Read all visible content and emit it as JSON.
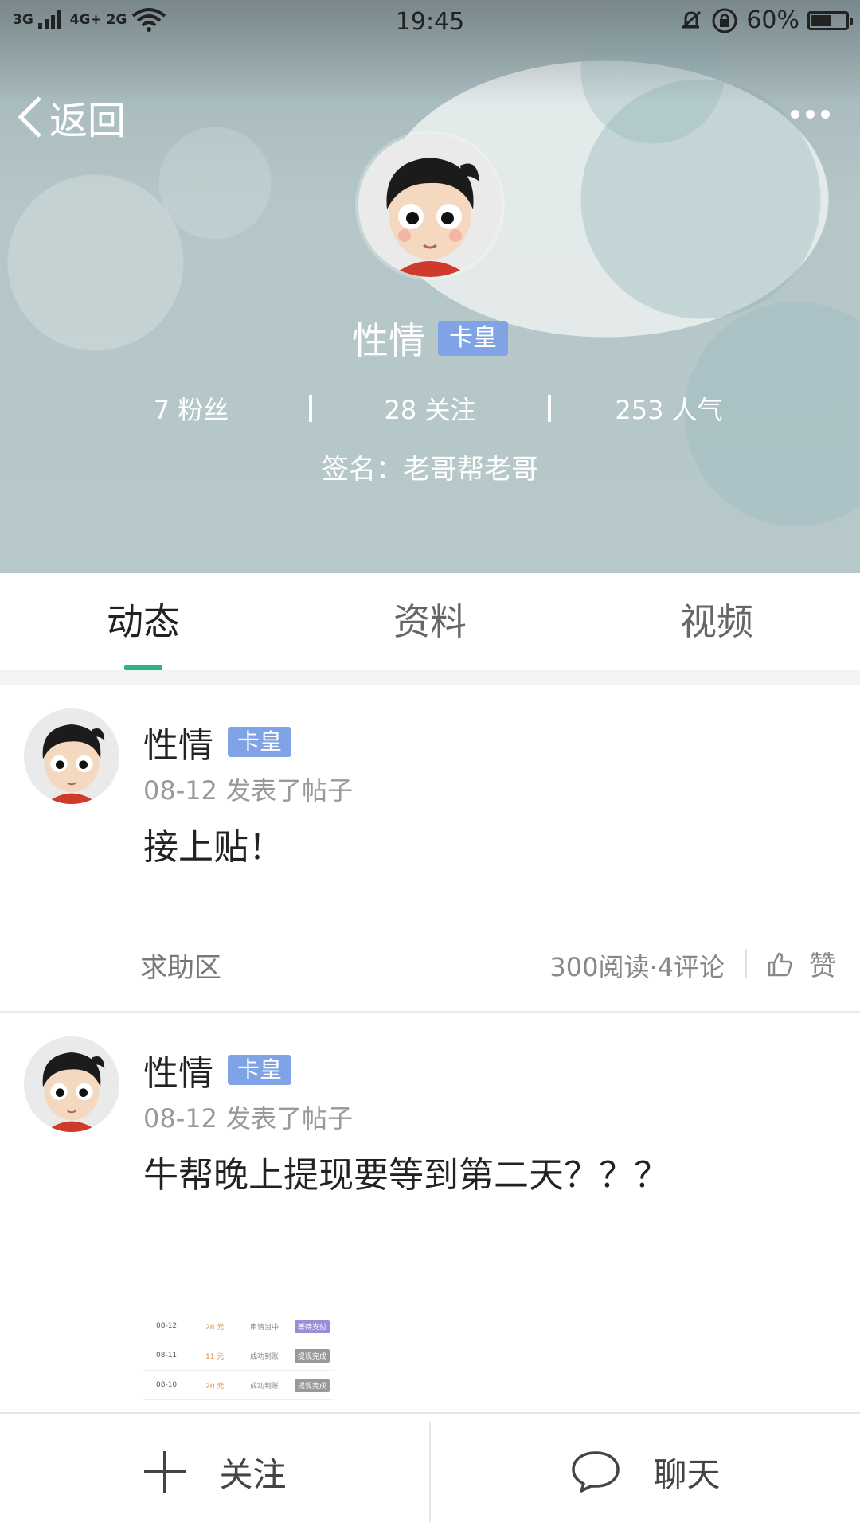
{
  "status_bar": {
    "network_1": "3G",
    "network_2": "4G+",
    "network_3": "2G",
    "time": "19:45",
    "battery_percent": "60%",
    "battery_level": 0.6,
    "icons": [
      "signal-icon",
      "wifi-icon",
      "mute-bell-icon",
      "rotation-lock-icon",
      "battery-icon"
    ]
  },
  "nav": {
    "back_label": "返回",
    "more_icon": "more-dots-icon"
  },
  "profile": {
    "name": "性情",
    "badge": "卡皇",
    "stats": [
      {
        "value": "7",
        "label": "粉丝"
      },
      {
        "value": "28",
        "label": "关注"
      },
      {
        "value": "253",
        "label": "人气"
      }
    ],
    "stat_texts": [
      "7 粉丝",
      "28 关注",
      "253 人气"
    ],
    "signature": "签名：老哥帮老哥"
  },
  "tabs": [
    {
      "label": "动态",
      "active": true
    },
    {
      "label": "资料",
      "active": false
    },
    {
      "label": "视频",
      "active": false
    }
  ],
  "accent_color": "#2ab28a",
  "badge_color": "#7fa3e4",
  "posts": [
    {
      "author": "性情",
      "badge": "卡皇",
      "meta": "08-12 发表了帖子",
      "content": "接上贴！",
      "forum": "求助区",
      "counts": "300阅读·4评论",
      "like_label": "赞"
    },
    {
      "author": "性情",
      "badge": "卡皇",
      "meta": "08-12 发表了帖子",
      "content": "牛帮晚上提现要等到第二天？？？",
      "thumbnail_rows": [
        {
          "date": "08-12",
          "amount": "28 元",
          "status": "申请当中",
          "tag": "等待支付"
        },
        {
          "date": "08-11",
          "amount": "11 元",
          "status": "成功到账",
          "tag": "提现完成"
        },
        {
          "date": "08-10",
          "amount": "20 元",
          "status": "成功到账",
          "tag": "提现完成"
        }
      ]
    }
  ],
  "bottom_bar": {
    "follow_label": "关注",
    "chat_label": "聊天"
  }
}
